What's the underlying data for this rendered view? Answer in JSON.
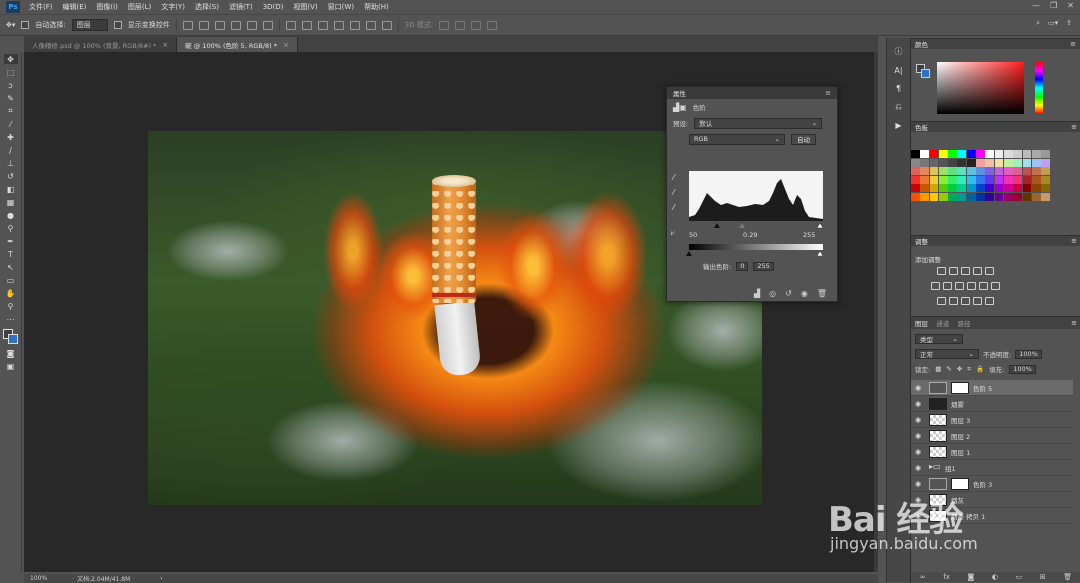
{
  "menubar": {
    "logo": "Ps",
    "items": [
      "文件(F)",
      "编辑(E)",
      "图像(I)",
      "图层(L)",
      "文字(Y)",
      "选择(S)",
      "滤镜(T)",
      "3D(D)",
      "视图(V)",
      "窗口(W)",
      "帮助(H)"
    ]
  },
  "options": {
    "auto_select_label": "自动选择:",
    "auto_select_value": "图层",
    "show_transform_label": "显示变换控件",
    "mode_3d_label": "3D 模式:"
  },
  "tabs": [
    {
      "label": "人像精修.psd @ 100% (背景, RGB/8#) *",
      "active": false
    },
    {
      "label": "碗 @ 100% (色阶 5, RGB/8) *",
      "active": true
    }
  ],
  "properties_panel": {
    "tab": "属性",
    "title": "色阶",
    "preset_label": "预设:",
    "preset_value": "默认",
    "channel": "RGB",
    "auto_button": "自动",
    "input_black": "50",
    "input_gamma": "0.29",
    "input_white": "255",
    "output_label": "输出色阶:",
    "output_black": "0",
    "output_white": "255"
  },
  "right_panels": {
    "color_tab": "颜色",
    "swatches_tab": "色板",
    "adjustments_tab": "调整",
    "adjustments_add": "添加调整",
    "layers_tabs": [
      "图层",
      "通道",
      "路径"
    ],
    "kind_filter": "类型",
    "blend_mode": "正常",
    "opacity_label": "不透明度:",
    "opacity_value": "100%",
    "lock_label": "锁定:",
    "fill_label": "填充:",
    "fill_value": "100%",
    "layers": [
      {
        "name": "色阶 5",
        "type": "adjust",
        "selected": true
      },
      {
        "name": "烟雾",
        "type": "thumb",
        "selected": false
      },
      {
        "name": "图层 3",
        "type": "thumb",
        "selected": false
      },
      {
        "name": "图层 2",
        "type": "thumb",
        "selected": false
      },
      {
        "name": "图层 1",
        "type": "thumb",
        "selected": false
      },
      {
        "name": "组1",
        "type": "folder",
        "selected": false
      },
      {
        "name": "色阶 3",
        "type": "adjust",
        "selected": false
      },
      {
        "name": "烟灰",
        "type": "thumb",
        "selected": false
      },
      {
        "name": "烟蒂 拷贝 1",
        "type": "thumb",
        "selected": false
      }
    ]
  },
  "status": {
    "zoom": "100%",
    "doc_size": "文档:2.04M/41.8M"
  },
  "watermark": {
    "brand": "Bai 经验",
    "url": "jingyan.baidu.com"
  },
  "colors": {
    "foreground": "#3c4044",
    "background": "#2f6fc8",
    "accent_red": "#ff1d1d"
  }
}
